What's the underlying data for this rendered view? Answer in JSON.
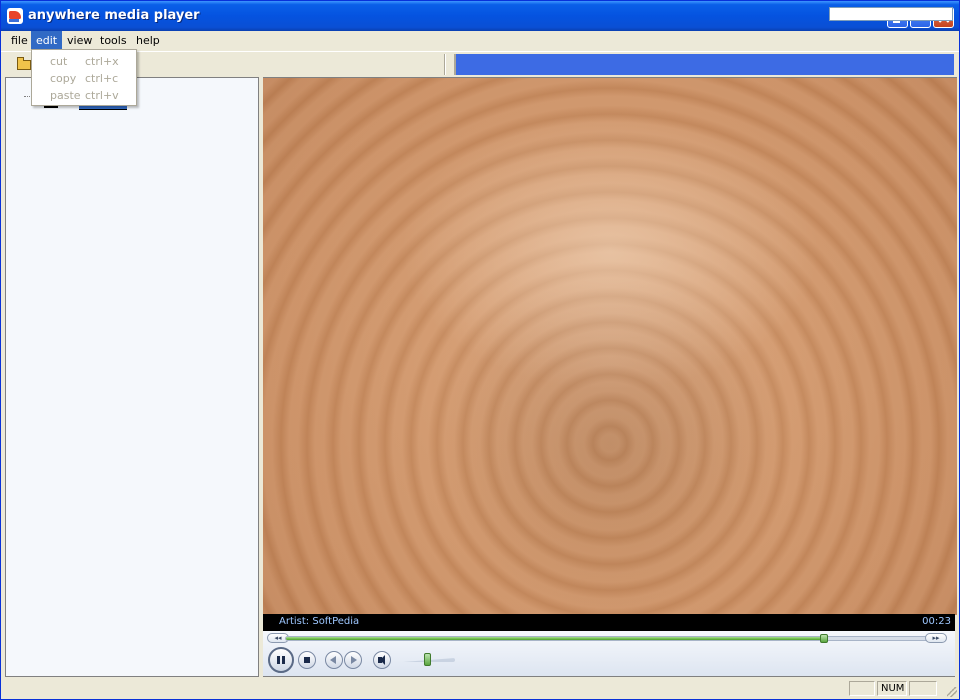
{
  "window": {
    "title": "anywhere media player"
  },
  "menu": {
    "file": "file",
    "edit": "edit",
    "view": "view",
    "tools": "tools",
    "help": "help"
  },
  "edit_menu": {
    "items": [
      {
        "label": "cut",
        "shortcut": "ctrl+x"
      },
      {
        "label": "copy",
        "shortcut": "ctrl+c"
      },
      {
        "label": "paste",
        "shortcut": "ctrl+v"
      }
    ]
  },
  "player": {
    "artist_label": "Artist:",
    "artist": "SoftPedia",
    "elapsed": "00:23",
    "seek_fraction": 0.83,
    "volume_fraction": 0.5
  },
  "statusbar": {
    "num": "NUM"
  },
  "colors": {
    "titlebar": "#0553e0",
    "menu_highlight": "#316ac5",
    "seek_fill": "#4ca32a",
    "video_tint": "#cf9468"
  }
}
